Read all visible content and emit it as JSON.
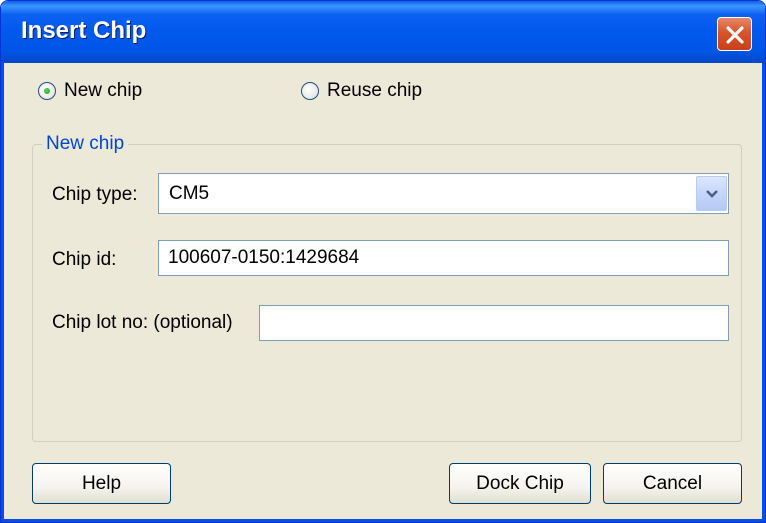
{
  "window": {
    "title": "Insert Chip"
  },
  "mode": {
    "options": [
      {
        "label": "New chip",
        "selected": true
      },
      {
        "label": "Reuse chip",
        "selected": false
      }
    ]
  },
  "group": {
    "legend": "New chip",
    "chip_type": {
      "label": "Chip type:",
      "value": "CM5"
    },
    "chip_id": {
      "label": "Chip id:",
      "value": "100607-0150:1429684"
    },
    "chip_lot": {
      "label": "Chip lot no: (optional)",
      "value": ""
    }
  },
  "buttons": {
    "help": "Help",
    "dock": "Dock Chip",
    "cancel": "Cancel"
  },
  "icons": {
    "close": "close-icon",
    "dropdown": "chevron-down-icon"
  },
  "colors": {
    "title_bar": "#0058ee",
    "close_button": "#d9532a",
    "dialog_background": "#ece9d8",
    "group_legend": "#0046d5",
    "radio_selected_dot": "#21a121"
  }
}
